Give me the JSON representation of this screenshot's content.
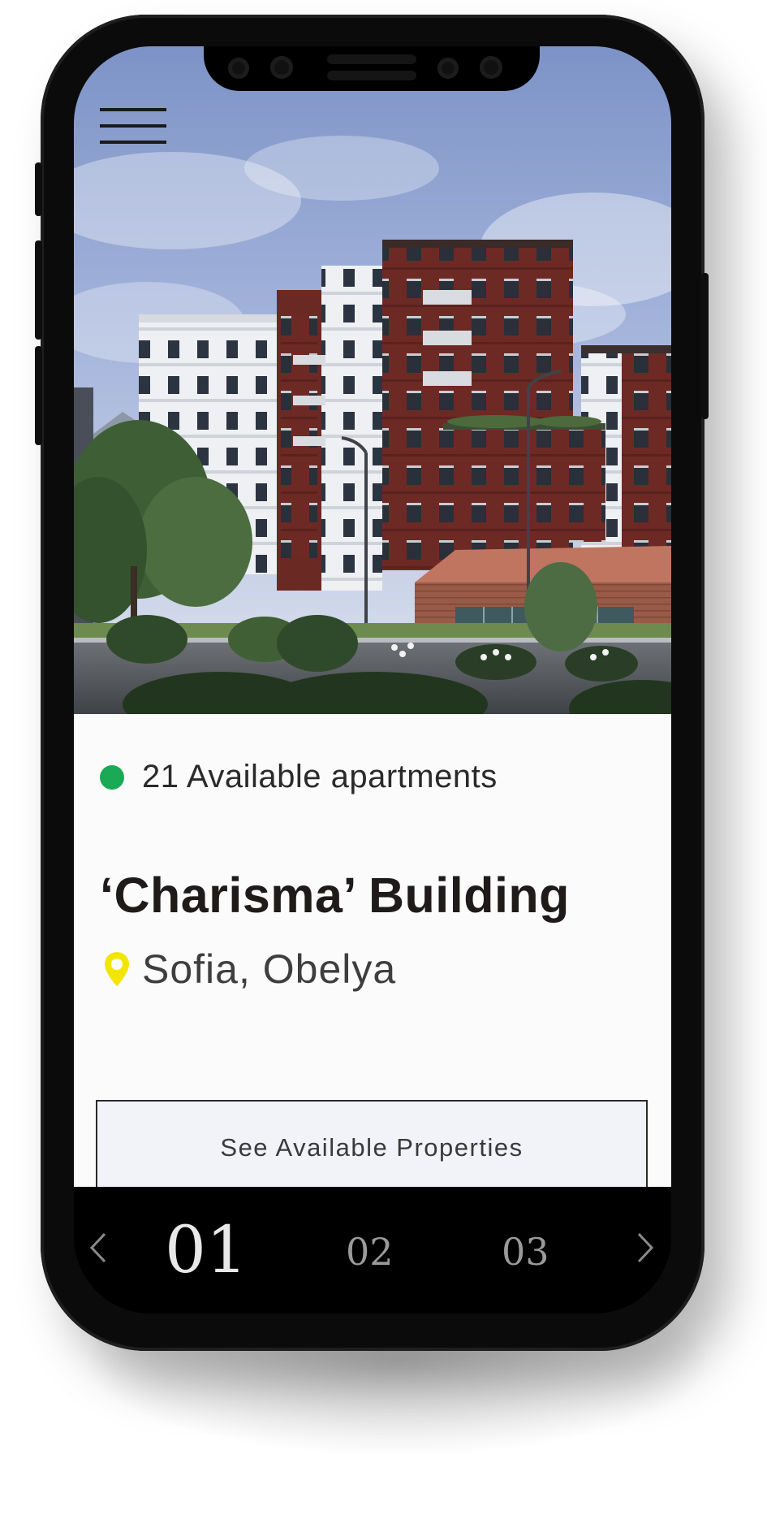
{
  "menu": {
    "icon": "hamburger-menu-icon"
  },
  "hero": {
    "alt": ""
  },
  "listing": {
    "availability": "21 Available apartments",
    "status_color": "#1aaa55",
    "title": "‘Charisma’ Building",
    "location": "Sofia, Obelya",
    "pin_color": "#f2e600",
    "cta_label": "See Available Properties"
  },
  "pager": {
    "pages": [
      "01",
      "02",
      "03"
    ],
    "active_page": "01",
    "prev_icon": "chevron-left-icon",
    "next_icon": "chevron-right-icon"
  }
}
